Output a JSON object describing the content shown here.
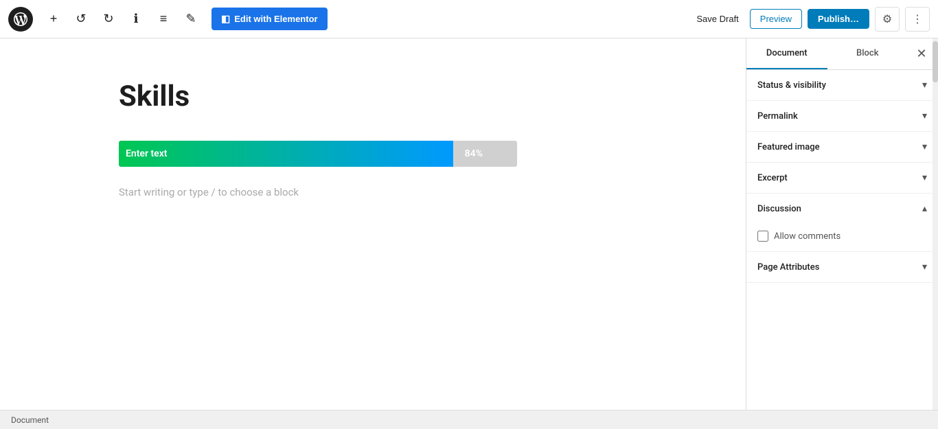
{
  "toolbar": {
    "add_label": "+",
    "undo_label": "↺",
    "redo_label": "↻",
    "info_label": "ℹ",
    "list_label": "≡",
    "edit_label": "✎",
    "edit_elementor_label": "Edit with Elementor",
    "save_draft_label": "Save Draft",
    "preview_label": "Preview",
    "publish_label": "Publish…",
    "settings_label": "⚙",
    "more_label": "⋮"
  },
  "sidebar": {
    "tab_document": "Document",
    "tab_block": "Block",
    "close_label": "✕",
    "sections": [
      {
        "id": "status-visibility",
        "label": "Status & visibility",
        "expanded": false
      },
      {
        "id": "permalink",
        "label": "Permalink",
        "expanded": false
      },
      {
        "id": "featured-image",
        "label": "Featured image",
        "expanded": false
      },
      {
        "id": "excerpt",
        "label": "Excerpt",
        "expanded": false
      },
      {
        "id": "discussion",
        "label": "Discussion",
        "expanded": true
      },
      {
        "id": "page-attributes",
        "label": "Page Attributes",
        "expanded": false
      }
    ],
    "discussion": {
      "allow_comments_label": "Allow comments",
      "allow_comments_checked": false
    }
  },
  "canvas": {
    "post_title": "Skills",
    "progress_bar_text": "Enter text",
    "progress_bar_percent": "84%",
    "progress_bar_fill_width": "84",
    "placeholder_text": "Start writing or type / to choose a block"
  },
  "status_bar": {
    "label": "Document"
  }
}
